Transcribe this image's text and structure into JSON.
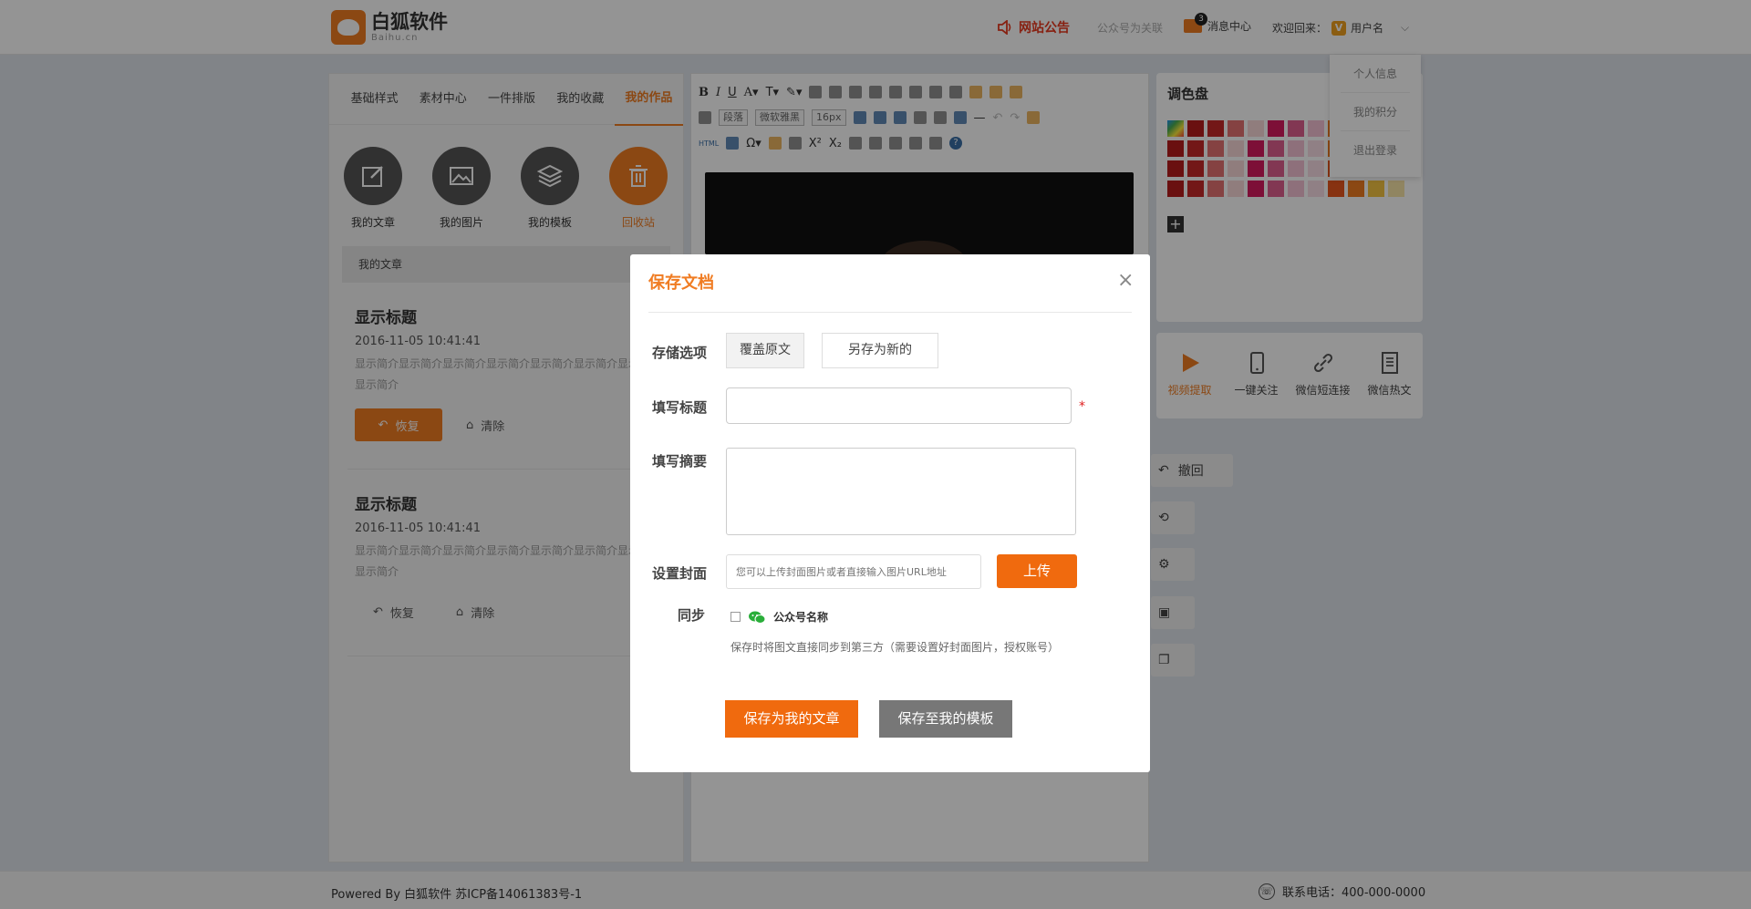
{
  "header": {
    "logo_name": "白狐软件",
    "logo_sub": "Baihu.cn",
    "notice": "网站公告",
    "bind_account": "公众号为关联",
    "message_count": "3",
    "message_center": "消息中心",
    "welcome": "欢迎回来：",
    "vip": "V",
    "username": "用户名"
  },
  "user_menu": [
    "个人信息",
    "我的积分",
    "退出登录"
  ],
  "left_tabs": [
    "基础样式",
    "素材中心",
    "一件排版",
    "我的收藏",
    "我的作品"
  ],
  "works": [
    {
      "label": "我的文章",
      "icon": "edit-icon"
    },
    {
      "label": "我的图片",
      "icon": "image-icon"
    },
    {
      "label": "我的模板",
      "icon": "layers-icon"
    },
    {
      "label": "回收站",
      "icon": "trash-icon"
    }
  ],
  "crumb": "我的文章",
  "articles": [
    {
      "title": "显示标题",
      "time": "2016-11-05 10:41:41",
      "desc": "显示简介显示简介显示简介显示简介显示简介显示简介显示简介显示简介",
      "restore": "恢复",
      "clear": "清除"
    },
    {
      "title": "显示标题",
      "time": "2016-11-05 10:41:41",
      "desc": "显示简介显示简介显示简介显示简介显示简介显示简介显示简介显示简介",
      "restore": "恢复",
      "clear": "清除"
    }
  ],
  "editor": {
    "paragraph": "段落",
    "font": "微软雅黑",
    "size": "16px"
  },
  "palette": {
    "title": "调色盘",
    "colors": [
      "#e53935",
      "#b71c1c",
      "#c62828",
      "#e57373",
      "#f8d7d7",
      "#d81b60",
      "#e06090",
      "#f4c2d5",
      "#f07c22",
      "#f5a623",
      "#f8d580",
      "#f9e6a8",
      "#b71c1c",
      "#c62828",
      "#e57373",
      "#f8d7d7",
      "#d81b60",
      "#e06090",
      "#f4c2d5",
      "#f9dce6",
      "#f07c22",
      "#f5a623",
      "#f8d580",
      "#f9e6a8",
      "#b71c1c",
      "#c62828",
      "#e57373",
      "#f8d7d7",
      "#d81b60",
      "#e06090",
      "#f4c2d5",
      "#f9dce6",
      "#e8561e",
      "#f07c22",
      "#f5c542",
      "#f9e6a8",
      "#b71c1c",
      "#c62828",
      "#e57373",
      "#f8d7d7",
      "#d81b60",
      "#e06090",
      "#f4c2d5",
      "#f9dce6",
      "#e8561e",
      "#f07c22",
      "#f5c542",
      "#f9e6a8"
    ]
  },
  "tools": [
    {
      "label": "视频提取",
      "icon": "play-icon"
    },
    {
      "label": "一键关注",
      "icon": "phone-icon"
    },
    {
      "label": "微信短连接",
      "icon": "link-icon"
    },
    {
      "label": "微信热文",
      "icon": "doc-icon"
    }
  ],
  "side_actions": {
    "undo": "撤回"
  },
  "footer": {
    "left": "Powered By 白狐软件 苏ICP备14061383号-1",
    "right": "联系电话：400-000-0000"
  },
  "modal": {
    "title": "保存文档",
    "storage_label": "存储选项",
    "opt_cover": "覆盖原文",
    "opt_new": "另存为新的",
    "title_label": "填写标题",
    "title_value": "",
    "required_mark": "*",
    "summary_label": "填写摘要",
    "summary_value": "",
    "cover_label": "设置封面",
    "cover_placeholder": "您可以上传封面图片或者直接输入图片URL地址",
    "upload": "上传",
    "sync_label": "同步",
    "sync_account": "公众号名称",
    "sync_hint": "保存时将图文直接同步到第三方（需要设置好封面图片，授权账号）",
    "save_article": "保存为我的文章",
    "save_template": "保存至我的模板"
  }
}
